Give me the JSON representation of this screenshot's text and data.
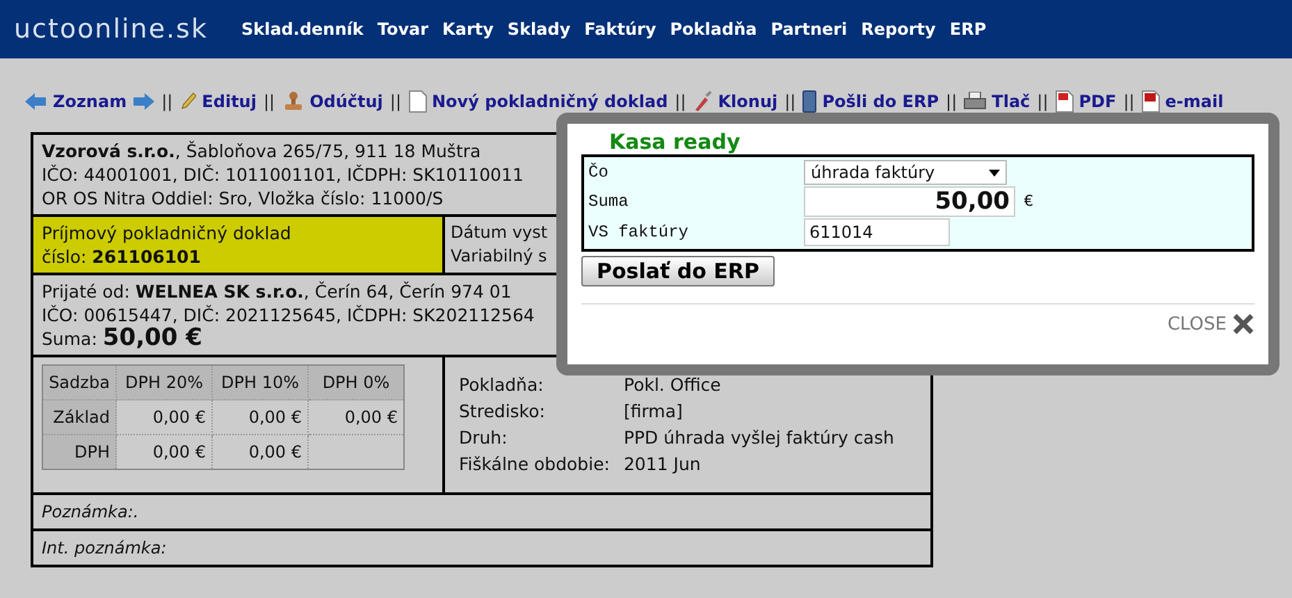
{
  "header": {
    "logo": "uctoonline.sk",
    "nav": [
      "Sklad.denník",
      "Tovar",
      "Karty",
      "Sklady",
      "Faktúry",
      "Pokladňa",
      "Partneri",
      "Reporty",
      "ERP"
    ]
  },
  "toolbar": [
    {
      "kind": "link",
      "label": "Zoznam"
    },
    {
      "kind": "separator",
      "label": "||"
    },
    {
      "kind": "link",
      "label": "Edituj"
    },
    {
      "kind": "separator",
      "label": "||"
    },
    {
      "kind": "link",
      "label": "Odúčtuj"
    },
    {
      "kind": "separator",
      "label": "||"
    },
    {
      "kind": "link",
      "label": "Nový pokladničný doklad"
    },
    {
      "kind": "separator",
      "label": "||"
    },
    {
      "kind": "link",
      "label": "Klonuj"
    },
    {
      "kind": "separator",
      "label": "||"
    },
    {
      "kind": "link",
      "label": "Pošli do ERP"
    },
    {
      "kind": "separator",
      "label": "||"
    },
    {
      "kind": "link",
      "label": "Tlač"
    },
    {
      "kind": "separator",
      "label": "||"
    },
    {
      "kind": "link",
      "label": "PDF"
    },
    {
      "kind": "separator",
      "label": "||"
    },
    {
      "kind": "link",
      "label": "e-mail"
    }
  ],
  "document": {
    "issuer": [
      "**Vzorová s.r.o.**, Šabloňova 265/75, 911 18 Muštra",
      "IČO: 44001001, DIČ: 1011001101, IČDPH: SK10110011",
      "OR OS Nitra Oddiel: Sro, Vložka číslo: 11000/S"
    ],
    "doc_type": [
      "Príjmový pokladničný doklad",
      "číslo: **261106101**"
    ],
    "dates": [
      "Dátum vyst",
      "Variabilný s"
    ],
    "received": [
      "Prijaté od: **WELNEA SK s.r.o.**, Čerín 64, Čerín 974 01",
      "IČO: 00615447, DIČ: 2021125645, IČDPH: SK202112564"
    ],
    "sum_label": "Suma:",
    "sum_value": "50,00 €",
    "vat_table": {
      "columns": [
        "Sadzba",
        "DPH 20%",
        "DPH 10%",
        "DPH 0%"
      ],
      "rows": [
        {
          "cells": [
            "Základ",
            "0,00 €",
            "0,00 €",
            "0,00 €"
          ]
        },
        {
          "cells": [
            "DPH",
            "0,00 €",
            "0,00 €"
          ]
        }
      ]
    },
    "info": [
      {
        "key": "Pokladňa:",
        "value": "Pokl. Office"
      },
      {
        "key": "Stredisko:",
        "value": "[firma]"
      },
      {
        "key": "Druh:",
        "value": "PPD úhrada vyšlej faktúry cash"
      },
      {
        "key": "Fiškálne obdobie:",
        "value": "2011 Jun"
      }
    ],
    "note": "Poznámka:.",
    "int_note": "Int. poznámka:"
  },
  "modal": {
    "title": "Kasa ready",
    "fields": [
      {
        "kind": "select",
        "label": "Čo",
        "value": "úhrada faktúry"
      },
      {
        "kind": "amount",
        "label": "Suma",
        "value": "50,00",
        "suffix": "€"
      },
      {
        "kind": "text",
        "label": "VS faktúry",
        "value": "611014"
      }
    ],
    "button": "Poslať do ERP",
    "close": "CLOSE"
  }
}
